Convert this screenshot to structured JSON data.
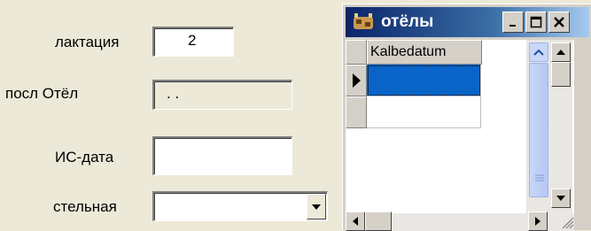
{
  "form": {
    "lactation_label": "лактация",
    "lactation_value": "2",
    "last_calving_label": "посл Отёл",
    "last_calving_value": ". .",
    "is_date_label": "ИС-дата",
    "is_date_value": "",
    "pregnant_label": "стельная",
    "pregnant_value": ""
  },
  "child_window": {
    "title": "отёлы",
    "minimize_icon": "minimize-icon",
    "maximize_icon": "maximize-icon",
    "close_icon": "close-icon",
    "grid": {
      "columns": [
        "Kalbedatum"
      ],
      "rows": [
        [
          ""
        ],
        [
          ""
        ]
      ],
      "selected_row": 0
    }
  },
  "colors": {
    "selection": "#0a64c8",
    "title_bar_start": "#0a246a",
    "form_bg": "#ece9d8"
  }
}
